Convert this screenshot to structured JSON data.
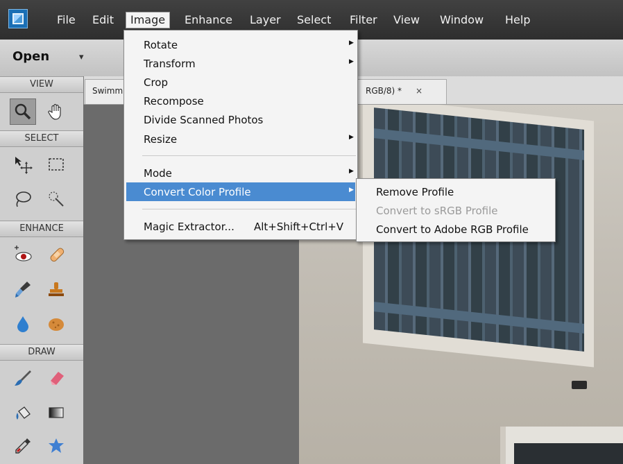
{
  "menubar": {
    "items": [
      "File",
      "Edit",
      "Image",
      "Enhance",
      "Layer",
      "Select",
      "Filter",
      "View",
      "Window",
      "Help"
    ],
    "active": "Image"
  },
  "optionsbar": {
    "open_label": "Open",
    "open_arrow": "▾"
  },
  "tab": {
    "left_text": "Swimm",
    "right_text": "RGB/8) *",
    "close": "×"
  },
  "toolbox": {
    "sections": [
      "VIEW",
      "SELECT",
      "ENHANCE",
      "DRAW"
    ],
    "tools": [
      "zoom-tool-icon",
      "hand-tool-icon",
      "move-tool-icon",
      "rectangular-marquee-icon",
      "lasso-icon",
      "quick-selection-icon",
      "red-eye-icon",
      "spot-healing-icon",
      "smart-brush-icon",
      "clone-stamp-icon",
      "blur-icon",
      "sponge-icon",
      "brush-icon",
      "eraser-icon",
      "paint-bucket-icon",
      "gradient-icon",
      "color-picker-icon",
      "custom-shape-icon"
    ]
  },
  "image_menu": {
    "rotate": "Rotate",
    "transform": "Transform",
    "crop": "Crop",
    "recompose": "Recompose",
    "divide": "Divide Scanned Photos",
    "resize": "Resize",
    "mode": "Mode",
    "convert": "Convert Color Profile",
    "magic": "Magic Extractor...",
    "magic_shortcut": "Alt+Shift+Ctrl+V",
    "submenu_arrow": "▶"
  },
  "convert_submenu": {
    "remove": "Remove Profile",
    "to_srgb": "Convert to sRGB Profile",
    "to_adobe": "Convert to Adobe RGB Profile"
  },
  "colors": {
    "highlight": "#4a8bd1",
    "menubar": "#343434",
    "disabled": "#9a9a9a"
  }
}
